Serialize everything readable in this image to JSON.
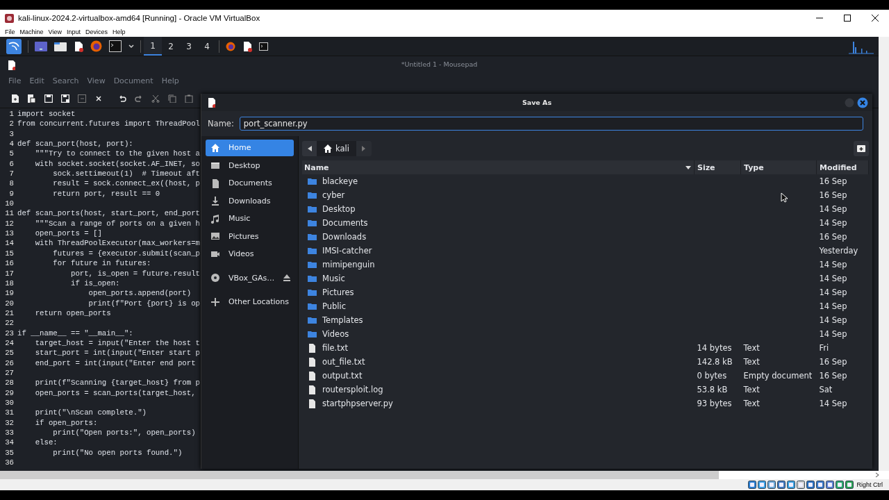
{
  "host_window": {
    "title": "kali-linux-2024.2-virtualbox-amd64 [Running] - Oracle VM VirtualBox",
    "menu": [
      "File",
      "Machine",
      "View",
      "Input",
      "Devices",
      "Help"
    ]
  },
  "panel": {
    "workspaces": [
      {
        "label": "1",
        "selected": true
      },
      {
        "label": "2",
        "selected": false
      },
      {
        "label": "3",
        "selected": false
      },
      {
        "label": "4",
        "selected": false
      }
    ]
  },
  "editor": {
    "title": "*Untitled 1 - Mousepad",
    "menu": [
      "File",
      "Edit",
      "Search",
      "View",
      "Document",
      "Help"
    ],
    "lines": [
      {
        "number": "1",
        "text": "import socket"
      },
      {
        "number": "2",
        "text": "from concurrent.futures import ThreadPool"
      },
      {
        "number": "3"
      },
      {
        "number": "4",
        "text": "def scan_port(host, port):"
      },
      {
        "number": "5",
        "text": "    \"\"\"Try to connect to the given host a"
      },
      {
        "number": "6",
        "text": "    with socket.socket(socket.AF_INET, so"
      },
      {
        "number": "7",
        "text": "        sock.settimeout(1)  # Timeout aft"
      },
      {
        "number": "8",
        "text": "        result = sock.connect_ex((host, p"
      },
      {
        "number": "9",
        "text": "        return port, result == 0"
      },
      {
        "number": "10"
      },
      {
        "number": "11",
        "text": "def scan_ports(host, start_port, end_port"
      },
      {
        "number": "12",
        "text": "    \"\"\"Scan a range of ports on a given h"
      },
      {
        "number": "13",
        "text": "    open_ports = []"
      },
      {
        "number": "14",
        "text": "    with ThreadPoolExecutor(max_workers=m"
      },
      {
        "number": "15",
        "text": "        futures = {executor.submit(scan_p"
      },
      {
        "number": "16",
        "text": "        for future in futures:"
      },
      {
        "number": "17",
        "text": "            port, is_open = future.result"
      },
      {
        "number": "18",
        "text": "            if is_open:"
      },
      {
        "number": "19",
        "text": "                open_ports.append(port)"
      },
      {
        "number": "20",
        "text": "                print(f\"Port {port} is op"
      },
      {
        "number": "21",
        "text": "    return open_ports"
      },
      {
        "number": "22"
      },
      {
        "number": "23",
        "text": "if __name__ == \"__main__\":"
      },
      {
        "number": "24",
        "text": "    target_host = input(\"Enter the host t"
      },
      {
        "number": "25",
        "text": "    start_port = int(input(\"Enter start p"
      },
      {
        "number": "26",
        "text": "    end_port = int(input(\"Enter end port"
      },
      {
        "number": "27"
      },
      {
        "number": "28",
        "text": "    print(f\"Scanning {target_host} from p"
      },
      {
        "number": "29",
        "text": "    open_ports = scan_ports(target_host,"
      },
      {
        "number": "30"
      },
      {
        "number": "31",
        "text": "    print(\"\\nScan complete.\")"
      },
      {
        "number": "32",
        "text": "    if open_ports:"
      },
      {
        "number": "33",
        "text": "        print(\"Open ports:\", open_ports)"
      },
      {
        "number": "34",
        "text": "    else:"
      },
      {
        "number": "35",
        "text": "        print(\"No open ports found.\")"
      },
      {
        "number": "36"
      }
    ]
  },
  "dialog": {
    "title": "Save As",
    "name_label": "Name:",
    "name_value": "port_scanner.py",
    "places": [
      {
        "label": "Home",
        "selected": true,
        "kind": "place"
      },
      {
        "label": "Desktop",
        "selected": false,
        "kind": "place"
      },
      {
        "label": "Documents",
        "selected": false,
        "kind": "place"
      },
      {
        "label": "Downloads",
        "selected": false,
        "kind": "place"
      },
      {
        "label": "Music",
        "selected": false,
        "kind": "place"
      },
      {
        "label": "Pictures",
        "selected": false,
        "kind": "place"
      },
      {
        "label": "Videos",
        "selected": false,
        "kind": "place"
      },
      {
        "label": "VBox_GAs…",
        "selected": false,
        "kind": "drive"
      },
      {
        "label": "Other Locations",
        "selected": false,
        "kind": "action"
      }
    ],
    "path": "kali",
    "columns": [
      "Name",
      "Size",
      "Type",
      "Modified"
    ],
    "files": [
      {
        "name": "blackeye",
        "kind": "folder",
        "modified": "16 Sep"
      },
      {
        "name": "cyber",
        "kind": "folder",
        "modified": "16 Sep"
      },
      {
        "name": "Desktop",
        "kind": "folder",
        "modified": "14 Sep"
      },
      {
        "name": "Documents",
        "kind": "folder",
        "modified": "14 Sep"
      },
      {
        "name": "Downloads",
        "kind": "folder",
        "modified": "16 Sep"
      },
      {
        "name": "IMSI-catcher",
        "kind": "folder",
        "modified": "Yesterday"
      },
      {
        "name": "mimipenguin",
        "kind": "folder",
        "modified": "14 Sep"
      },
      {
        "name": "Music",
        "kind": "folder",
        "modified": "14 Sep"
      },
      {
        "name": "Pictures",
        "kind": "folder",
        "modified": "14 Sep"
      },
      {
        "name": "Public",
        "kind": "folder",
        "modified": "14 Sep"
      },
      {
        "name": "Templates",
        "kind": "folder",
        "modified": "14 Sep"
      },
      {
        "name": "Videos",
        "kind": "folder",
        "modified": "14 Sep"
      },
      {
        "name": "file.txt",
        "kind": "file",
        "size": "14 bytes",
        "type": "Text",
        "modified": "Fri"
      },
      {
        "name": "out_file.txt",
        "kind": "file",
        "size": "142.8 kB",
        "type": "Text",
        "modified": "16 Sep"
      },
      {
        "name": "output.txt",
        "kind": "file",
        "size": "0 bytes",
        "type": "Empty document",
        "modified": "16 Sep"
      },
      {
        "name": "routersploit.log",
        "kind": "file",
        "size": "53.8 kB",
        "type": "Text",
        "modified": "Sat"
      },
      {
        "name": "startphpserver.py",
        "kind": "file",
        "size": "93 bytes",
        "type": "Text",
        "modified": "14 Sep"
      }
    ]
  },
  "status_bar": {
    "host_key": "Right Ctrl"
  }
}
